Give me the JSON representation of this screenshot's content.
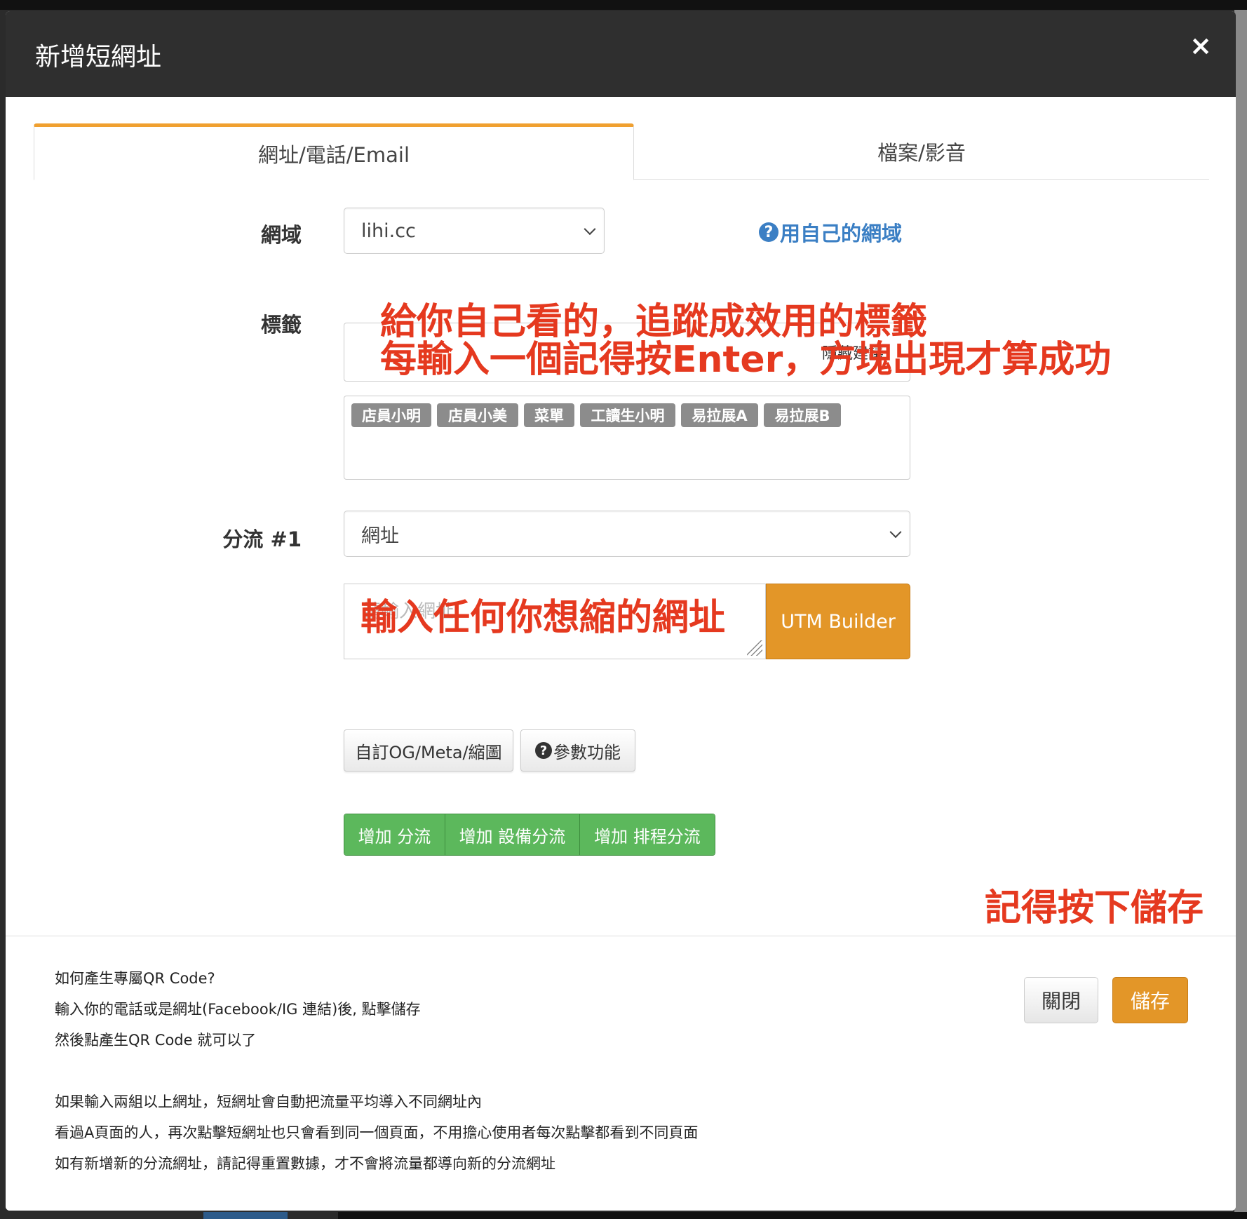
{
  "modal": {
    "title": "新增短網址",
    "close_icon": "×"
  },
  "tabs": [
    {
      "label": "網址/電話/Email",
      "active": true
    },
    {
      "label": "檔案/影音",
      "active": false
    }
  ],
  "domain": {
    "label": "網域",
    "value": "lihi.cc",
    "own_domain_icon": "?",
    "own_domain_link": "用自己的網域"
  },
  "tags": {
    "label": "標籤",
    "hide_suggestions": "隱藏建議",
    "chips": [
      "店員小明",
      "店員小美",
      "菜單",
      "工讀生小明",
      "易拉展A",
      "易拉展B"
    ]
  },
  "split": {
    "label": "分流 #1",
    "type_value": "網址",
    "url_placeholder": "請輸入網址",
    "utm_button": "UTM Builder"
  },
  "actions": {
    "og_meta": "自訂OG/Meta/縮圖",
    "params_icon": "?",
    "params": "參數功能",
    "add_split": "增加 分流",
    "add_device_split": "增加 設備分流",
    "add_schedule_split": "增加 排程分流"
  },
  "annotations": {
    "tags_line1": "給你自己看的，追蹤成效用的標籤",
    "tags_line2": "每輸入一個記得按Enter，方塊出現才算成功",
    "url_hint": "輸入任何你想縮的網址",
    "save_hint": "記得按下儲存"
  },
  "footer": {
    "help_lines": [
      "如何產生專屬QR Code?",
      "輸入你的電話或是網址(Facebook/IG 連結)後, 點擊儲存",
      "然後點產生QR Code 就可以了",
      "如果輸入兩組以上網址，短網址會自動把流量平均導入不同網址內",
      "看過A頁面的人，再次點擊短網址也只會看到同一個頁面，不用擔心使用者每次點擊都看到不同頁面",
      "如有新增新的分流網址，請記得重置數據，才不會將流量都導向新的分流網址"
    ],
    "close_button": "關閉",
    "save_button": "儲存"
  },
  "colors": {
    "accent_orange": "#e39628",
    "tab_active_border": "#f0a030",
    "link_blue": "#3b7fc4",
    "green_button": "#5cb85c",
    "annotation_red": "#e5391f",
    "header_bg": "#2f2f2f",
    "chip_gray": "#8c8c8c"
  }
}
